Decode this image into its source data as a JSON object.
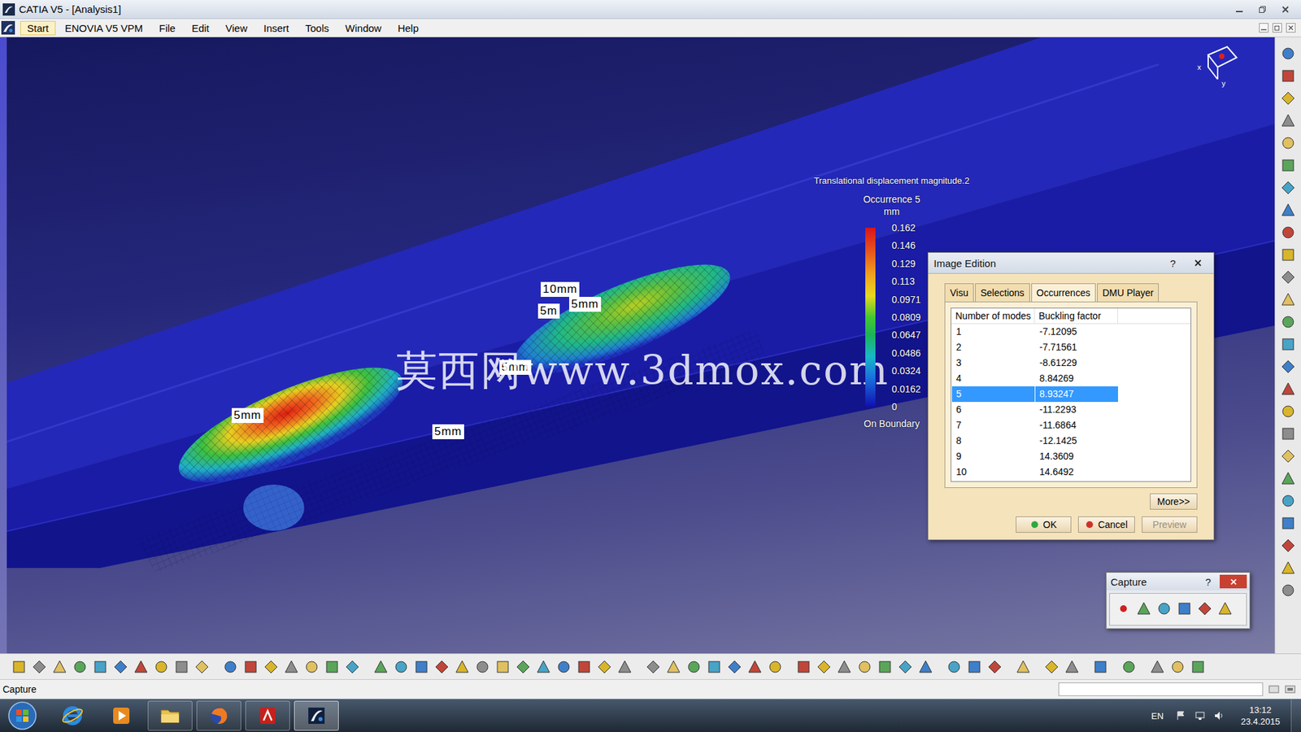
{
  "window": {
    "title": "CATIA V5 - [Analysis1]"
  },
  "menu": [
    {
      "label": "Start",
      "selected": true
    },
    {
      "label": "ENOVIA V5 VPM",
      "selected": false
    },
    {
      "label": "File",
      "selected": false
    },
    {
      "label": "Edit",
      "selected": false
    },
    {
      "label": "View",
      "selected": false
    },
    {
      "label": "Insert",
      "selected": false
    },
    {
      "label": "Tools",
      "selected": false
    },
    {
      "label": "Window",
      "selected": false
    },
    {
      "label": "Help",
      "selected": false
    }
  ],
  "viewport": {
    "labels": [
      "10mm",
      "5m",
      "5mm",
      "5mm",
      "5mm",
      "5mm"
    ],
    "watermark": "莫西网www.3dmox.com",
    "compass": {
      "x_axis": "x",
      "y_axis": "y"
    }
  },
  "legend": {
    "title": "Translational displacement magnitude.2",
    "occurrence": "Occurrence 5",
    "unit": "mm",
    "values": [
      "0.162",
      "0.146",
      "0.129",
      "0.113",
      "0.0971",
      "0.0809",
      "0.0647",
      "0.0486",
      "0.0324",
      "0.0162",
      "0"
    ],
    "footer": "On Boundary"
  },
  "dialog": {
    "title": "Image Edition",
    "help": "?",
    "tabs": [
      {
        "label": "Visu",
        "selected": false
      },
      {
        "label": "Selections",
        "selected": false
      },
      {
        "label": "Occurrences",
        "selected": true
      },
      {
        "label": "DMU Player",
        "selected": false
      }
    ],
    "table": {
      "columns": [
        "Number of modes",
        "Buckling factor"
      ],
      "rows": [
        {
          "mode": "1",
          "factor": "-7.12095",
          "selected": false
        },
        {
          "mode": "2",
          "factor": "-7.71561",
          "selected": false
        },
        {
          "mode": "3",
          "factor": "-8.61229",
          "selected": false
        },
        {
          "mode": "4",
          "factor": "8.84269",
          "selected": false
        },
        {
          "mode": "5",
          "factor": "8.93247",
          "selected": true
        },
        {
          "mode": "6",
          "factor": "-11.2293",
          "selected": false
        },
        {
          "mode": "7",
          "factor": "-11.6864",
          "selected": false
        },
        {
          "mode": "8",
          "factor": "-12.1425",
          "selected": false
        },
        {
          "mode": "9",
          "factor": "14.3609",
          "selected": false
        },
        {
          "mode": "10",
          "factor": "14.6492",
          "selected": false
        }
      ]
    },
    "more": "More>>",
    "buttons": [
      {
        "label": "OK",
        "kind": "ok",
        "disabled": false
      },
      {
        "label": "Cancel",
        "kind": "cancel",
        "disabled": false
      },
      {
        "label": "Preview",
        "kind": "plain",
        "disabled": true
      }
    ]
  },
  "capture": {
    "title": "Capture",
    "help": "?"
  },
  "status_bar": {
    "text": "Capture"
  },
  "taskbar": {
    "apps": [
      {
        "kind": "ie",
        "open": false,
        "selected": false
      },
      {
        "kind": "media",
        "open": false,
        "selected": false
      },
      {
        "kind": "explorer",
        "open": true,
        "selected": false
      },
      {
        "kind": "firefox",
        "open": true,
        "selected": false
      },
      {
        "kind": "acrobat",
        "open": true,
        "selected": false
      },
      {
        "kind": "catia",
        "open": true,
        "selected": true
      }
    ],
    "language": "EN",
    "time": "13:12",
    "date": "23.4.2015"
  }
}
